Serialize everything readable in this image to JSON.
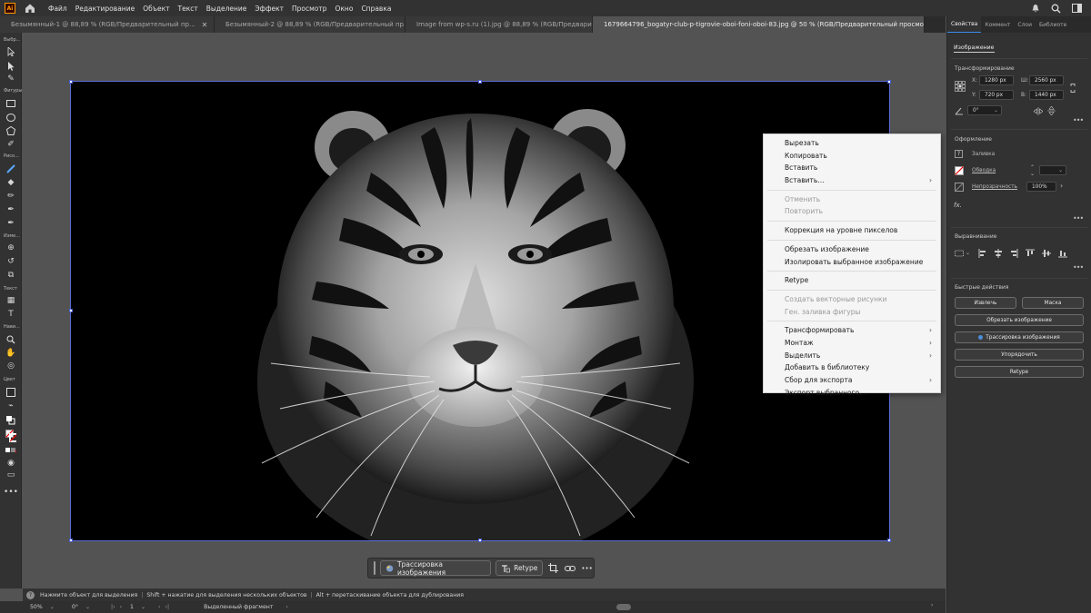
{
  "app": {
    "logo": "Ai",
    "accent": "#ff9a00"
  },
  "menubar": {
    "items": [
      "Файл",
      "Редактирование",
      "Объект",
      "Текст",
      "Выделение",
      "Эффект",
      "Просмотр",
      "Окно",
      "Справка"
    ]
  },
  "tabs": [
    {
      "label": "Безымянный-1 @ 88,89 % (RGB/Предварительный пр...",
      "active": false
    },
    {
      "label": "Безымянный-2 @ 88,89 % (RGB/Предварительный пр...",
      "active": false
    },
    {
      "label": "Image from wp-s.ru (1).jpg @ 88,89 % (RGB/Предварит...",
      "active": false
    },
    {
      "label": "1679664796_bogatyr-club-p-tigrovie-oboi-foni-oboi-83.jpg @ 50 % (RGB/Предварительный просмотр)",
      "active": true
    }
  ],
  "toolbar": {
    "labels": [
      "Выбр...",
      "Фигуры",
      "Рисо...",
      "Изме...",
      "Текст",
      "Нави...",
      "Цвет"
    ]
  },
  "context_menu": {
    "groups": [
      [
        {
          "label": "Вырезать"
        },
        {
          "label": "Копировать"
        },
        {
          "label": "Вставить"
        },
        {
          "label": "Вставить...",
          "submenu": true
        }
      ],
      [
        {
          "label": "Отменить",
          "disabled": true
        },
        {
          "label": "Повторить",
          "disabled": true
        }
      ],
      [
        {
          "label": "Коррекция на уровне пикселов"
        }
      ],
      [
        {
          "label": "Обрезать изображение"
        },
        {
          "label": "Изолировать выбранное изображение"
        }
      ],
      [
        {
          "label": "Retype"
        }
      ],
      [
        {
          "label": "Создать векторные рисунки",
          "disabled": true
        },
        {
          "label": "Ген. заливка фигуры",
          "disabled": true
        }
      ],
      [
        {
          "label": "Трансформировать",
          "submenu": true
        },
        {
          "label": "Монтаж",
          "submenu": true
        },
        {
          "label": "Выделить",
          "submenu": true
        },
        {
          "label": "Добавить в библиотеку"
        },
        {
          "label": "Сбор для экспорта",
          "submenu": true
        },
        {
          "label": "Экспорт выбранного..."
        }
      ]
    ]
  },
  "taskbar": {
    "trace_label": "Трассировка изображения",
    "retype_label": "Retype",
    "more": "•••"
  },
  "status": {
    "hint1": "Нажмите объект для выделения",
    "hint2": "Shift + нажатие для выделения нескольких объектов",
    "hint3": "Alt + перетаскивание объекта для дублирования",
    "help": "?"
  },
  "bottombar": {
    "zoom": "50%",
    "angle": "0°",
    "artboard_num": "1",
    "selection": "Выделенный фрагмент"
  },
  "panel": {
    "tabs": [
      "Свойства",
      "Коммент",
      "Слои",
      "Библиоте"
    ],
    "subtab": "Изображение",
    "transform": {
      "title": "Трансформирование",
      "x_label": "X:",
      "x": "1280 px",
      "y_label": "Y:",
      "y": "720 px",
      "w_label": "Ш:",
      "w": "2560 px",
      "h_label": "В:",
      "h": "1440 px",
      "angle": "0°"
    },
    "appearance": {
      "title": "Оформление",
      "fill": "Заливка",
      "stroke": "Обводка",
      "opacity_label": "Непрозрачность",
      "opacity": "100%",
      "fx": "fx."
    },
    "align": {
      "title": "Выравнивание"
    },
    "quick": {
      "title": "Быстрые действия",
      "extract": "Извлечь",
      "mask": "Маска",
      "crop": "Обрезать изображение",
      "trace": "Трассировка изображения",
      "arrange": "Упорядочить",
      "retype": "Retype"
    },
    "more": "•••"
  }
}
